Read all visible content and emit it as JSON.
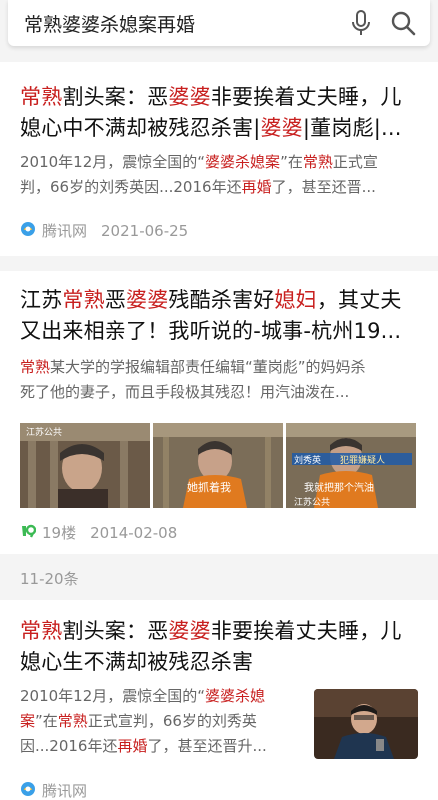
{
  "search": {
    "query": "常熟婆婆杀媳案再婚",
    "mic_icon": "microphone-icon",
    "search_icon": "search-icon"
  },
  "results": [
    {
      "title_line1": [
        "常熟",
        "割头案：恶",
        "婆婆",
        "非要挨着丈夫睡，儿"
      ],
      "title_line2": [
        "媳心中不满却被残忍杀害|",
        "婆婆",
        "|董岗彪|..."
      ],
      "snippet_line1": [
        "2010年12月，震惊全国的“",
        "婆婆杀媳案",
        "”在",
        "常熟",
        "正式宣"
      ],
      "snippet_line2": [
        "判，66岁的刘秀英因...2016年还",
        "再婚",
        "了，甚至还晋..."
      ],
      "source": "腾讯网",
      "source_icon": "tencent-news-icon",
      "date": "2021-06-25"
    },
    {
      "title_line1": [
        "江苏",
        "常熟",
        "恶",
        "婆婆",
        "残酷杀害好",
        "媳妇",
        "，其丈夫"
      ],
      "title_line2": [
        "又出来相亲了！我听说的-城事-杭州19..."
      ],
      "snippet_line1": [
        "常熟",
        "某大学的学报编辑部责任编辑“董岗彪”的妈妈杀"
      ],
      "snippet_line2": [
        "死了他的妻子，而且手段极其残忍！用汽油泼在..."
      ],
      "thumb_captions": [
        "江苏公共",
        "她抓着我",
        "刘秀英",
        "犯罪嫌疑人",
        "我就把那个汽油",
        "江苏公共"
      ],
      "source": "19楼",
      "source_icon": "19lou-icon",
      "date": "2014-02-08"
    },
    {
      "title_line1": [
        "常熟",
        "割头案：恶",
        "婆婆",
        "非要挨着丈夫睡，儿"
      ],
      "title_line2": [
        "媳心生不满却被残忍杀害"
      ],
      "snippet_line1": [
        "2010年12月，震惊全国的“",
        "婆婆杀媳"
      ],
      "snippet_line2": [
        "案",
        "”在",
        "常熟",
        "正式宣判，66岁的刘秀英"
      ],
      "snippet_line3": [
        "因...2016年还",
        "再婚",
        "了，甚至还晋升..."
      ],
      "source": "腾讯网",
      "source_icon": "tencent-news-icon"
    }
  ],
  "range_label": "11-20条",
  "colors": {
    "highlight": "#c8201f",
    "meta": "#999999"
  }
}
